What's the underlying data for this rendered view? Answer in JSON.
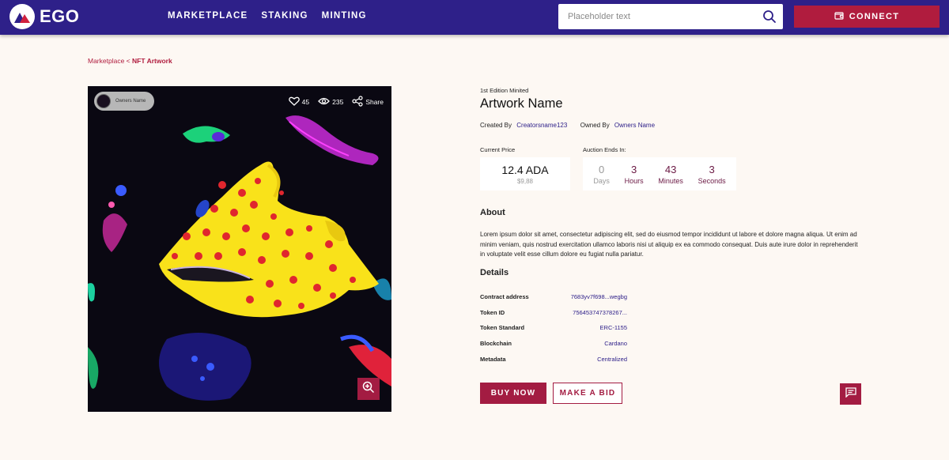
{
  "header": {
    "logo_text": "EGO",
    "nav": [
      "MARKETPLACE",
      "STAKING",
      "MINTING"
    ],
    "search_placeholder": "Placeholder text",
    "connect_label": "CONNECT"
  },
  "breadcrumb": {
    "parent": "Marketplace",
    "separator": " < ",
    "current": "NFT Artwork"
  },
  "artwork": {
    "owner_chip": "Owners Name",
    "likes": "45",
    "views": "235",
    "share_label": "Share"
  },
  "info": {
    "edition": "1st Edition Minited",
    "title": "Artwork Name",
    "created_by_label": "Created By",
    "creator": "Creatorsname123",
    "owned_by_label": "Owned By",
    "owner": "Owners Name",
    "current_price_label": "Current Price",
    "price_ada": "12.4 ADA",
    "price_usd": "$9,88",
    "auction_label": "Auction Ends In:",
    "timer": [
      {
        "value": "0",
        "label": "Days"
      },
      {
        "value": "3",
        "label": "Hours"
      },
      {
        "value": "43",
        "label": "Minutes"
      },
      {
        "value": "3",
        "label": "Seconds"
      }
    ],
    "about_heading": "About",
    "about_text": "Lorem ipsum dolor sit amet, consectetur adipiscing elit, sed do eiusmod tempor incididunt ut labore et dolore magna aliqua. Ut enim ad minim veniam, quis nostrud exercitation ullamco laboris nisi ut aliquip ex ea commodo consequat. Duis aute irure dolor in reprehenderit in voluptate velit esse cillum dolore eu fugiat nulla pariatur.",
    "details_heading": "Details",
    "details": [
      {
        "key": "Contract address",
        "value": "7683yv7f698...wegbg"
      },
      {
        "key": "Token ID",
        "value": "756453747378267..."
      },
      {
        "key": "Token Standard",
        "value": "ERC-1155"
      },
      {
        "key": "Blockchain",
        "value": "Cardano"
      },
      {
        "key": "Metadata",
        "value": "Centralized"
      }
    ],
    "buy_label": "BUY NOW",
    "bid_label": "MAKE A BID"
  },
  "colors": {
    "header_bg": "#2e2089",
    "accent": "#a31c42",
    "link": "#2e2089",
    "page_bg": "#fdf8f3"
  }
}
